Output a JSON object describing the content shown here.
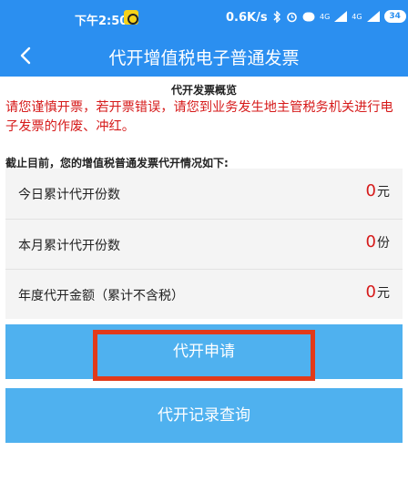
{
  "status_bar": {
    "time": "下午2:50",
    "network_speed": "0.6K/s",
    "icons": [
      "bluetooth-icon",
      "alarm-icon",
      "hd-icon",
      "4g-signal-icon",
      "4g-signal-icon"
    ],
    "signal_text_1": "4G",
    "signal_text_2": "4G",
    "battery": "34"
  },
  "nav": {
    "title": "代开增值税电子普通发票"
  },
  "overview": {
    "title": "代开发票概览",
    "warning": "请您谨慎开票，若开票错误，请您到业务发生地主管税务机关进行电子发票的作废、冲红。",
    "summary_label": "截止目前，您的增值税普通发票代开情况如下:"
  },
  "stats": [
    {
      "label": "今日累计代开份数",
      "value": "0",
      "unit": "元"
    },
    {
      "label": "本月累计代开份数",
      "value": "0",
      "unit": "份"
    },
    {
      "label": "年度代开金额（累计不含税）",
      "value": "0",
      "unit": "元"
    }
  ],
  "buttons": {
    "apply": "代开申请",
    "records": "代开记录查询"
  },
  "colors": {
    "primary": "#2b8ff0",
    "button": "#4fb1ef",
    "warning": "#d61a1a",
    "highlight": "#e23a1a"
  }
}
